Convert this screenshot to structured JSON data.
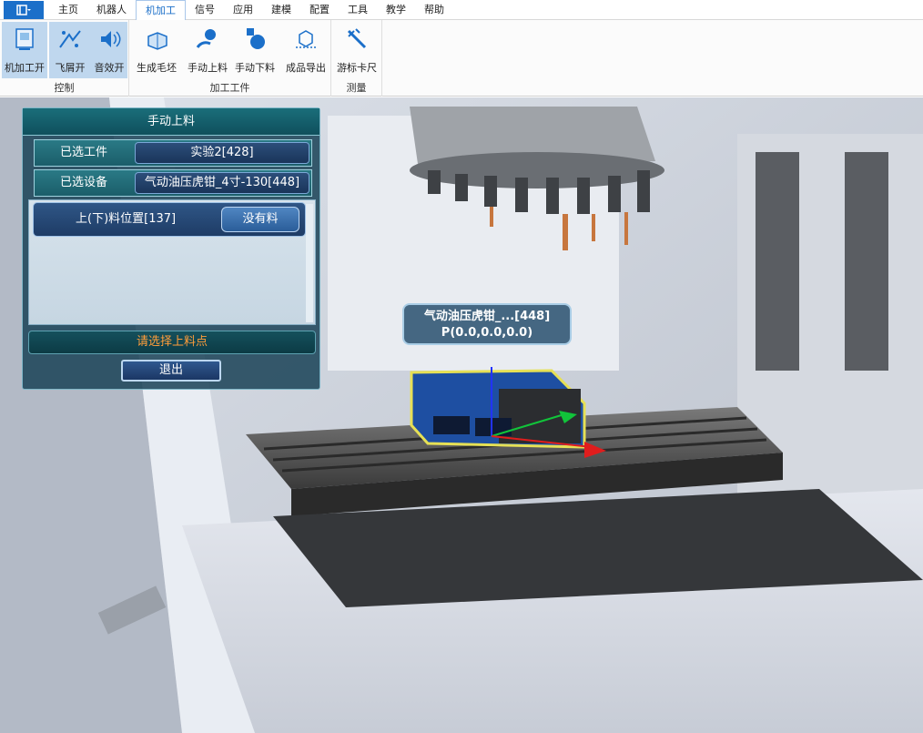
{
  "menu": {
    "app_icon": "menu-icon",
    "items": [
      {
        "label": "主页"
      },
      {
        "label": "机器人"
      },
      {
        "label": "机加工",
        "active": true
      },
      {
        "label": "信号"
      },
      {
        "label": "应用"
      },
      {
        "label": "建模"
      },
      {
        "label": "配置"
      },
      {
        "label": "工具"
      },
      {
        "label": "教学"
      },
      {
        "label": "帮助"
      }
    ]
  },
  "ribbon": {
    "groups": [
      {
        "label": "控制",
        "buttons": [
          {
            "label": "机加工开",
            "icon": "machining-icon",
            "on": true
          },
          {
            "label": "飞屑开",
            "icon": "chips-icon",
            "on": true
          },
          {
            "label": "音效开",
            "icon": "sound-icon",
            "on": true
          }
        ]
      },
      {
        "label": "加工工件",
        "buttons": [
          {
            "label": "生成毛坯",
            "icon": "blank-icon"
          },
          {
            "label": "手动上料",
            "icon": "load-icon"
          },
          {
            "label": "手动下料",
            "icon": "unload-icon"
          },
          {
            "label": "成品导出",
            "icon": "export-icon"
          }
        ]
      },
      {
        "label": "测量",
        "buttons": [
          {
            "label": "游标卡尺",
            "icon": "caliper-icon"
          }
        ]
      }
    ]
  },
  "panel": {
    "title": "手动上料",
    "workpiece_key": "已选工件",
    "workpiece_value": "实验2[428]",
    "device_key": "已选设备",
    "device_value": "气动油压虎钳_4寸-130[448]",
    "positions": [
      {
        "label": "上(下)料位置[137]",
        "state": "没有料"
      }
    ],
    "hint": "请选择上料点",
    "exit_label": "退出"
  },
  "scene_tag": {
    "line1": "气动油压虎钳_...[448]",
    "line2": "P(0.0,0.0,0.0)"
  },
  "colors": {
    "accent": "#1b6fc9",
    "hint_text": "#ff9d3a",
    "panel_bg": "#1e465a"
  }
}
